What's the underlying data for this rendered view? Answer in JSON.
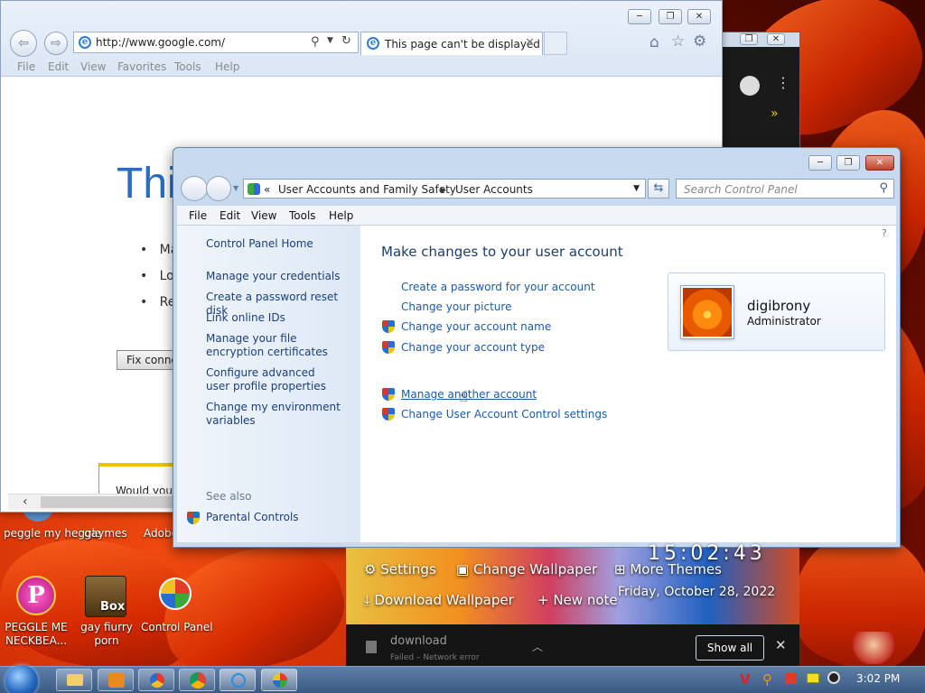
{
  "ie": {
    "url": "http://www.google.com/",
    "tab_title": "This page can't be displayed",
    "menu": [
      "File",
      "Edit",
      "View",
      "Favorites",
      "Tools",
      "Help"
    ],
    "heading_fragment": "Thi",
    "bullets": [
      "Ma",
      "Loc",
      "Ref"
    ],
    "fix_button": "Fix conne",
    "notify_text": "Would you l"
  },
  "cp": {
    "breadcrumb_root": "«",
    "breadcrumb_1": "User Accounts and Family Safety",
    "breadcrumb_sep": "▸",
    "breadcrumb_2": "User Accounts",
    "search_placeholder": "Search Control Panel",
    "menu": [
      "File",
      "Edit",
      "View",
      "Tools",
      "Help"
    ],
    "left_links": {
      "home": "Control Panel Home",
      "credentials": "Manage your credentials",
      "reset_disk": "Create a password reset disk",
      "online_ids": "Link online IDs",
      "encryption": "Manage your file encryption certificates",
      "profile_props": "Configure advanced user profile properties",
      "env_vars": "Change my environment variables"
    },
    "see_also": "See also",
    "parental": "Parental Controls",
    "heading": "Make changes to your user account",
    "tasks": {
      "create_password": "Create a password for your account",
      "change_picture": "Change your picture",
      "change_name": "Change your account name",
      "change_type": "Change your account type",
      "manage_other": "Manage another account",
      "uac": "Change User Account Control settings"
    },
    "user": {
      "name": "digibrony",
      "role": "Administrator"
    }
  },
  "desktop": {
    "icons": [
      "peggle my heggle",
      "gaymes",
      "Adobe",
      "PEGGLE ME NECKBEA...",
      "gay fiurry porn",
      "Control Panel"
    ],
    "box_label": "Box"
  },
  "gadget": {
    "settings": "Settings",
    "change_wallpaper": "Change Wallpaper",
    "more_themes": "More Themes",
    "download_wallpaper": "Download Wallpaper",
    "new_note": "+ New note",
    "clock": "15:02:43",
    "date": "Friday, October 28, 2022"
  },
  "download": {
    "name": "download",
    "status": "Failed – Network error",
    "show_all": "Show all"
  },
  "taskbar": {
    "clock": "3:02 PM"
  },
  "colors": {
    "link": "#1c5aa8",
    "heading": "#1c3d6e",
    "taskbar": "#3a5a84"
  }
}
